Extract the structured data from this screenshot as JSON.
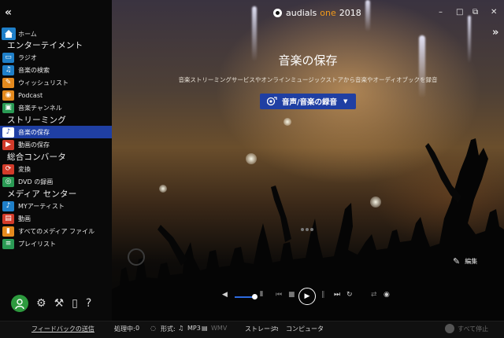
{
  "app": {
    "brand_name": "audials",
    "brand_edition": "one",
    "brand_year": "2018",
    "accent_color": "#1f3fa3",
    "edition_color": "#f39a1a",
    "window_controls": [
      "–",
      "□",
      "⧉",
      "✕"
    ]
  },
  "sidebar": {
    "collapse_glyph": "«",
    "home_label": "ホーム",
    "sections": [
      {
        "title": "エンターテイメント",
        "items": [
          {
            "label": "ラジオ",
            "icon": "radio-icon",
            "color": "#1f7fc8",
            "active": false
          },
          {
            "label": "音楽の検索",
            "icon": "music-search-icon",
            "color": "#1f7fc8",
            "active": false
          },
          {
            "label": "ウィッシュリスト",
            "icon": "wishlist-icon",
            "color": "#e48a1e",
            "active": false
          },
          {
            "label": "Podcast",
            "icon": "podcast-icon",
            "color": "#e48a1e",
            "active": false
          },
          {
            "label": "音楽チャンネル",
            "icon": "music-channel-icon",
            "color": "#2a9a54",
            "active": false
          }
        ]
      },
      {
        "title": "ストリーミング",
        "items": [
          {
            "label": "音楽の保存",
            "icon": "music-record-icon",
            "color": "#1f7fc8",
            "active": true
          },
          {
            "label": "動画の保存",
            "icon": "video-record-icon",
            "color": "#d23b2a",
            "active": false
          }
        ]
      },
      {
        "title": "総合コンバータ",
        "items": [
          {
            "label": "変換",
            "icon": "convert-icon",
            "color": "#d23b2a",
            "active": false
          },
          {
            "label": "DVD の録画",
            "icon": "dvd-icon",
            "color": "#2a9a54",
            "active": false
          }
        ]
      },
      {
        "title": "メディア センター",
        "items": [
          {
            "label": "MYアーティスト",
            "icon": "artist-icon",
            "color": "#1f7fc8",
            "active": false
          },
          {
            "label": "動画",
            "icon": "film-icon",
            "color": "#d23b2a",
            "active": false
          },
          {
            "label": "すべてのメディア ファイル",
            "icon": "media-files-icon",
            "color": "#e48a1e",
            "active": false
          },
          {
            "label": "プレイリスト",
            "icon": "playlist-icon",
            "color": "#2a9a54",
            "active": false
          }
        ]
      }
    ]
  },
  "main": {
    "expand_glyph": "»",
    "title": "音楽の保存",
    "subtitle": "音楽ストリーミングサービスやオンラインミュージックストアから音楽やオーディオブックを録音",
    "record_button_label": "音声/音楽の録音",
    "edit_label": "編集"
  },
  "statusbar": {
    "feedback_label": "フィードバックの送信",
    "processing_label": "処理中:",
    "processing_count": "0",
    "format_label": "形式:",
    "format_audio": "MP3",
    "format_video": "WMV",
    "storage_label": "ストレージ:",
    "storage_value": "コンピュータ",
    "stop_all_label": "すべて停止"
  }
}
